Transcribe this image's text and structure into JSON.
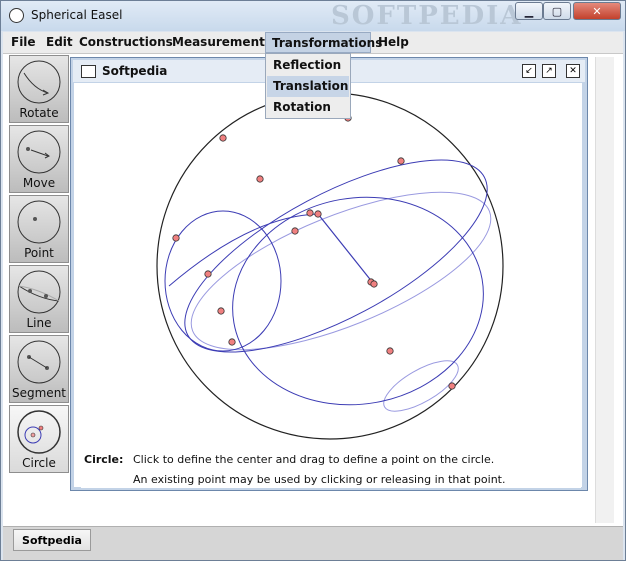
{
  "window": {
    "title": "Spherical Easel",
    "watermark": "SOFTPEDIA"
  },
  "menubar": {
    "items": [
      "File",
      "Edit",
      "Constructions",
      "Measurements",
      "Transformations",
      "Help"
    ]
  },
  "transformations_menu": {
    "items": [
      "Reflection",
      "Translation",
      "Rotation"
    ],
    "highlighted": "Translation"
  },
  "tools": [
    "Rotate",
    "Move",
    "Point",
    "Line",
    "Segment",
    "Circle"
  ],
  "selected_tool": "Circle",
  "inner_window": {
    "title": "Softpedia"
  },
  "hint": {
    "label": "Circle:",
    "line1": "Click to define the center and drag to define a point on the circle.",
    "line2": "An existing point may be used by clicking or releasing in that point."
  },
  "taskbar": {
    "item": "Softpedia"
  },
  "colors": {
    "point_fill": "#f08080",
    "curve": "#3c3cb4",
    "light_curve": "#9a9ae0"
  }
}
